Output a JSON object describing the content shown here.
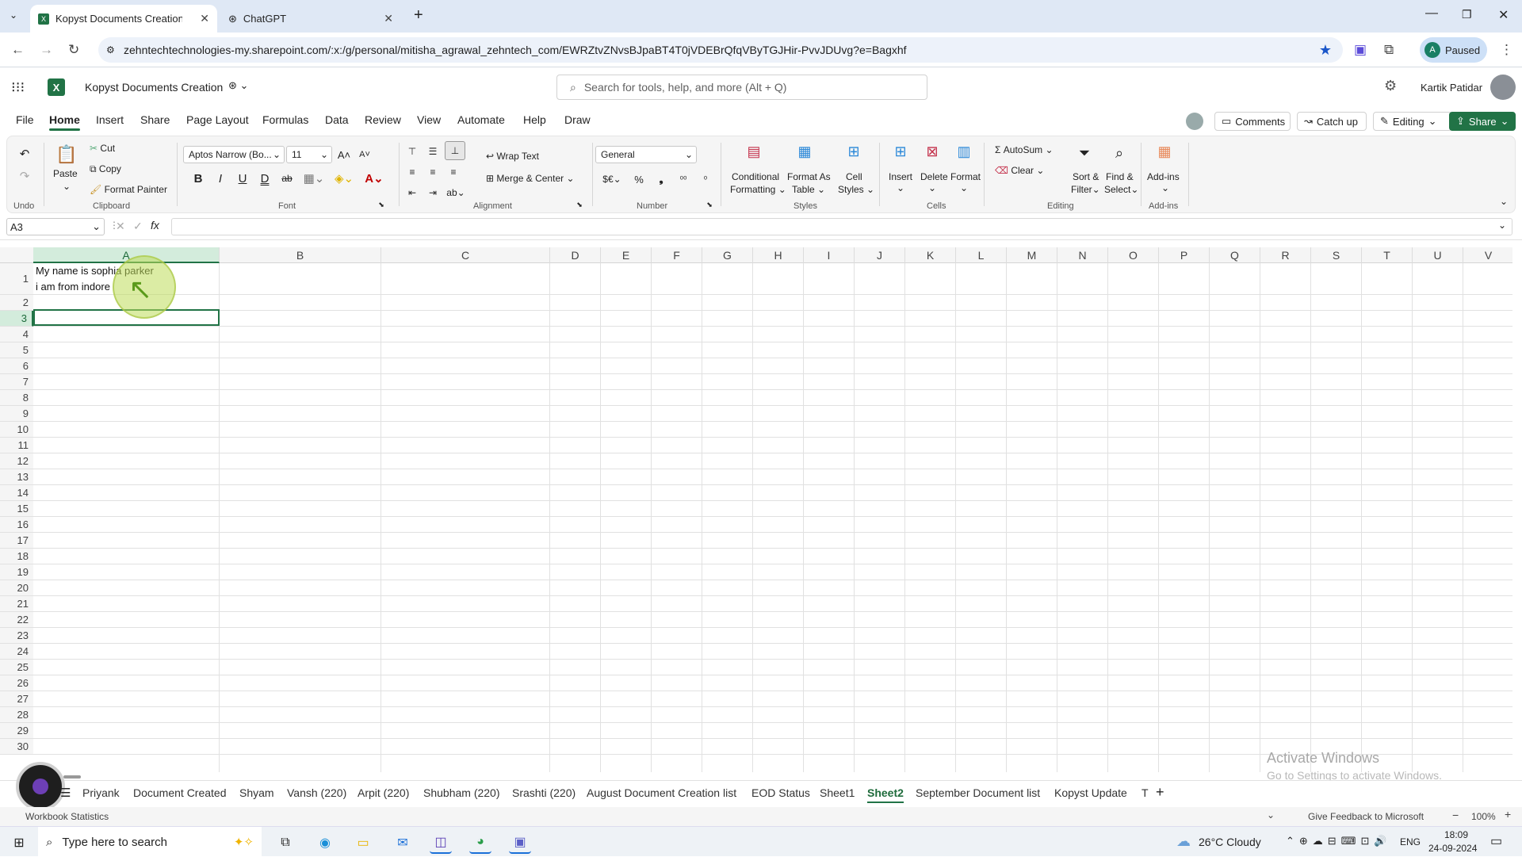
{
  "browser": {
    "tabs": [
      {
        "label": "Kopyst Documents Creation.xlsx",
        "active": true
      },
      {
        "label": "ChatGPT",
        "active": false
      }
    ],
    "url": "zehntechtechnologies-my.sharepoint.com/:x:/g/personal/mitisha_agrawal_zehntech_com/EWRZtvZNvsBJpaBT4T0jVDEBrQfqVByTGJHir-PvvJDUvg?e=Bagxhf",
    "profile_letter": "A",
    "profile_status": "Paused"
  },
  "app": {
    "doc_title": "Kopyst Documents Creation",
    "search_placeholder": "Search for tools, help, and more (Alt + Q)",
    "user_name": "Kartik Patidar"
  },
  "menu": {
    "items": [
      "File",
      "Home",
      "Insert",
      "Share",
      "Page Layout",
      "Formulas",
      "Data",
      "Review",
      "View",
      "Automate",
      "Help",
      "Draw"
    ],
    "active": "Home",
    "comments": "Comments",
    "catch_up": "Catch up",
    "editing": "Editing",
    "share": "Share"
  },
  "ribbon": {
    "undo_group": "Undo",
    "paste": "Paste",
    "cut": "Cut",
    "copy": "Copy",
    "format_painter": "Format Painter",
    "clipboard_group": "Clipboard",
    "font_name": "Aptos Narrow (Bo...",
    "font_size": "11",
    "bold": "B",
    "italic": "I",
    "underline": "U",
    "double_underline": "D",
    "strike": "ab",
    "font_group": "Font",
    "wrap_text": "Wrap Text",
    "merge_center": "Merge & Center",
    "alignment_group": "Alignment",
    "number_format": "General",
    "number_group": "Number",
    "cond_format_1": "Conditional",
    "cond_format_2": "Formatting",
    "format_table_1": "Format As",
    "format_table_2": "Table",
    "cell_styles_1": "Cell",
    "cell_styles_2": "Styles",
    "styles_group": "Styles",
    "insert": "Insert",
    "delete": "Delete",
    "format": "Format",
    "cells_group": "Cells",
    "autosum": "AutoSum",
    "clear": "Clear",
    "sort_1": "Sort &",
    "sort_2": "Filter",
    "find_1": "Find &",
    "find_2": "Select",
    "editing_group": "Editing",
    "addins": "Add-ins",
    "addins_group": "Add-ins"
  },
  "formula_bar": {
    "name_box": "A3",
    "formula": ""
  },
  "grid": {
    "columns": [
      "A",
      "B",
      "C",
      "D",
      "E",
      "F",
      "G",
      "H",
      "I",
      "J",
      "K",
      "L",
      "M",
      "N",
      "O",
      "P",
      "Q",
      "R",
      "S",
      "T",
      "U",
      "V"
    ],
    "selected_column": "A",
    "rows": [
      "1",
      "2",
      "3",
      "4",
      "5",
      "6",
      "7",
      "8",
      "9",
      "10",
      "11",
      "12",
      "13",
      "14",
      "15",
      "16",
      "17",
      "18",
      "19",
      "20",
      "21",
      "22",
      "23",
      "24",
      "25",
      "26",
      "27",
      "28",
      "29",
      "30"
    ],
    "selected_row": "3",
    "cell_A1_line1": "My name is sophia parker",
    "cell_A1_line2": "i am from indore"
  },
  "sheets": {
    "tabs": [
      "Priyank",
      "Document Created",
      "Shyam",
      "Vansh (220)",
      "Arpit (220)",
      "Shubham (220)",
      "Srashti (220)",
      "August Document Creation list",
      "EOD Status",
      "Sheet1",
      "Sheet2",
      "September Document list",
      "Kopyst Update",
      "T"
    ],
    "active": "Sheet2"
  },
  "status": {
    "workbook_stats": "Workbook Statistics",
    "feedback": "Give Feedback to Microsoft",
    "zoom": "100%"
  },
  "watermark": {
    "line1": "Activate Windows",
    "line2": "Go to Settings to activate Windows."
  },
  "taskbar": {
    "search": "Type here to search",
    "weather": "26°C  Cloudy",
    "lang": "ENG",
    "time": "18:09",
    "date": "24-09-2024"
  },
  "colors": {
    "accent": "#217346",
    "selection": "#d3ecdc"
  }
}
